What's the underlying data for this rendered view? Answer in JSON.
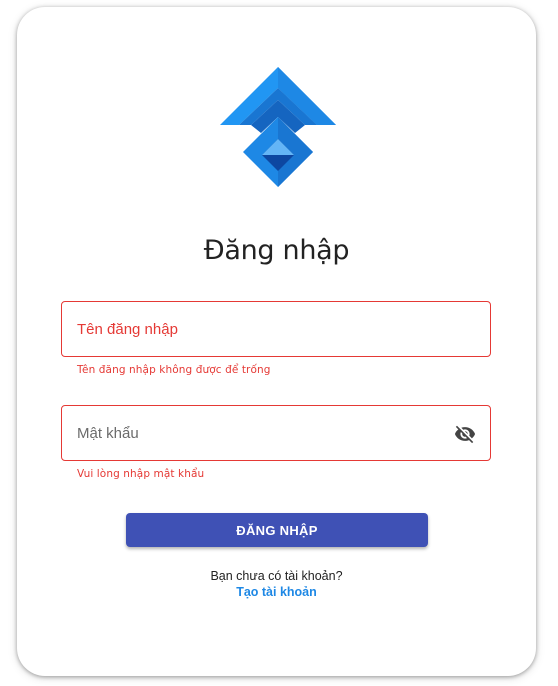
{
  "login": {
    "title": "Đăng nhập",
    "username": {
      "placeholder": "Tên đăng nhập",
      "value": "",
      "error": "Tên đăng nhập không được để trống"
    },
    "password": {
      "placeholder": "Mật khẩu",
      "value": "",
      "error": "Vui lòng nhập mật khẩu",
      "toggle_icon": "eye-off-icon"
    },
    "submit_label": "ĐĂNG NHẬP",
    "signup_prompt": "Bạn chưa có tài khoản?",
    "signup_link": "Tạo tài khoản"
  },
  "colors": {
    "primary_button": "#3f51b5",
    "error": "#e53935",
    "link": "#1e88e5",
    "logo_light": "#2196f3",
    "logo_dark": "#1565c0"
  }
}
